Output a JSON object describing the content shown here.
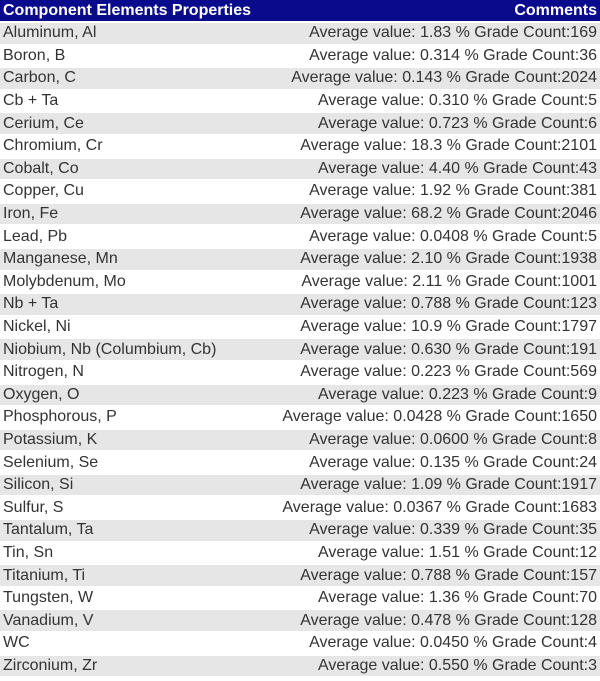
{
  "table": {
    "headers": {
      "name": "Component Elements Properties",
      "comment": "Comments"
    },
    "colors": {
      "header_bg": "#0a0a8c",
      "header_text": "#ffffff",
      "row_odd_bg": "#e6e6e6",
      "row_even_bg": "#ffffff",
      "text": "#333333"
    },
    "rows": [
      {
        "name": "Aluminum, Al",
        "comment": "Average value: 1.83 % Grade Count:169"
      },
      {
        "name": "Boron, B",
        "comment": "Average value: 0.314 % Grade Count:36"
      },
      {
        "name": "Carbon, C",
        "comment": "Average value: 0.143 % Grade Count:2024"
      },
      {
        "name": "Cb + Ta",
        "comment": "Average value: 0.310 % Grade Count:5"
      },
      {
        "name": "Cerium, Ce",
        "comment": "Average value: 0.723 % Grade Count:6"
      },
      {
        "name": "Chromium, Cr",
        "comment": "Average value: 18.3 % Grade Count:2101"
      },
      {
        "name": "Cobalt, Co",
        "comment": "Average value: 4.40 % Grade Count:43"
      },
      {
        "name": "Copper, Cu",
        "comment": "Average value: 1.92 % Grade Count:381"
      },
      {
        "name": "Iron, Fe",
        "comment": "Average value: 68.2 % Grade Count:2046"
      },
      {
        "name": "Lead, Pb",
        "comment": "Average value: 0.0408 % Grade Count:5"
      },
      {
        "name": "Manganese, Mn",
        "comment": "Average value: 2.10 % Grade Count:1938"
      },
      {
        "name": "Molybdenum, Mo",
        "comment": "Average value: 2.11 % Grade Count:1001"
      },
      {
        "name": "Nb + Ta",
        "comment": "Average value: 0.788 % Grade Count:123"
      },
      {
        "name": "Nickel, Ni",
        "comment": "Average value: 10.9 % Grade Count:1797"
      },
      {
        "name": "Niobium, Nb (Columbium, Cb)",
        "comment": "Average value: 0.630 % Grade Count:191"
      },
      {
        "name": "Nitrogen, N",
        "comment": "Average value: 0.223 % Grade Count:569"
      },
      {
        "name": "Oxygen, O",
        "comment": "Average value: 0.223 % Grade Count:9"
      },
      {
        "name": "Phosphorous, P",
        "comment": "Average value: 0.0428 % Grade Count:1650"
      },
      {
        "name": "Potassium, K",
        "comment": "Average value: 0.0600 % Grade Count:8"
      },
      {
        "name": "Selenium, Se",
        "comment": "Average value: 0.135 % Grade Count:24"
      },
      {
        "name": "Silicon, Si",
        "comment": "Average value: 1.09 % Grade Count:1917"
      },
      {
        "name": "Sulfur, S",
        "comment": "Average value: 0.0367 % Grade Count:1683"
      },
      {
        "name": "Tantalum, Ta",
        "comment": "Average value: 0.339 % Grade Count:35"
      },
      {
        "name": "Tin, Sn",
        "comment": "Average value: 1.51 % Grade Count:12"
      },
      {
        "name": "Titanium, Ti",
        "comment": "Average value: 0.788 % Grade Count:157"
      },
      {
        "name": "Tungsten, W",
        "comment": "Average value: 1.36 % Grade Count:70"
      },
      {
        "name": "Vanadium, V",
        "comment": "Average value: 0.478 % Grade Count:128"
      },
      {
        "name": "WC",
        "comment": "Average value: 0.0450 % Grade Count:4"
      },
      {
        "name": "Zirconium, Zr",
        "comment": "Average value: 0.550 % Grade Count:3"
      }
    ]
  }
}
